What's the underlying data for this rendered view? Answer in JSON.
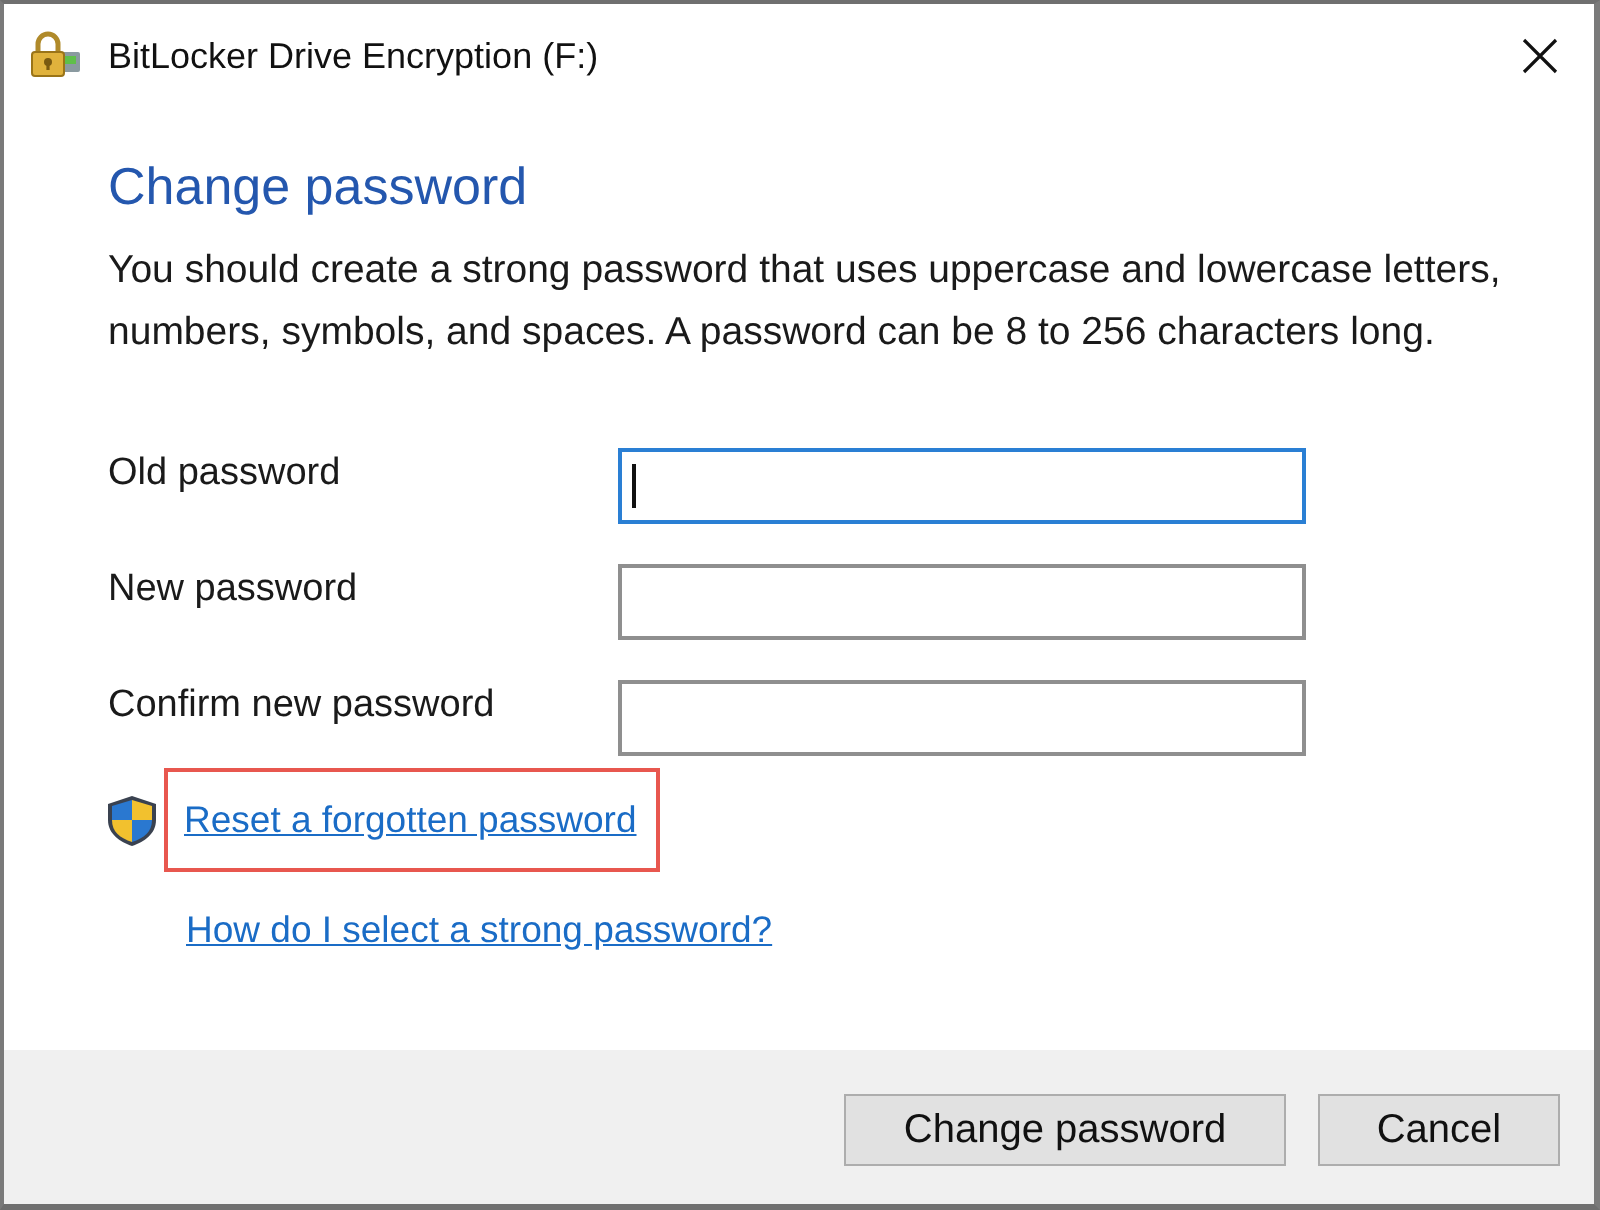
{
  "window": {
    "title": "BitLocker Drive Encryption (F:)"
  },
  "heading": "Change password",
  "instructions": "You should create a strong password that uses uppercase and lowercase letters, numbers, symbols, and spaces. A password can be 8 to 256 characters long.",
  "fields": [
    {
      "label": "Old password",
      "focused": true
    },
    {
      "label": "New password",
      "focused": false
    },
    {
      "label": "Confirm new password",
      "focused": false
    }
  ],
  "links": [
    {
      "text": "Reset a forgotten password",
      "shield": true,
      "highlighted": true
    },
    {
      "text": "How do I select a strong password?",
      "shield": false,
      "highlighted": false
    }
  ],
  "buttons": [
    "Change password",
    "Cancel"
  ]
}
